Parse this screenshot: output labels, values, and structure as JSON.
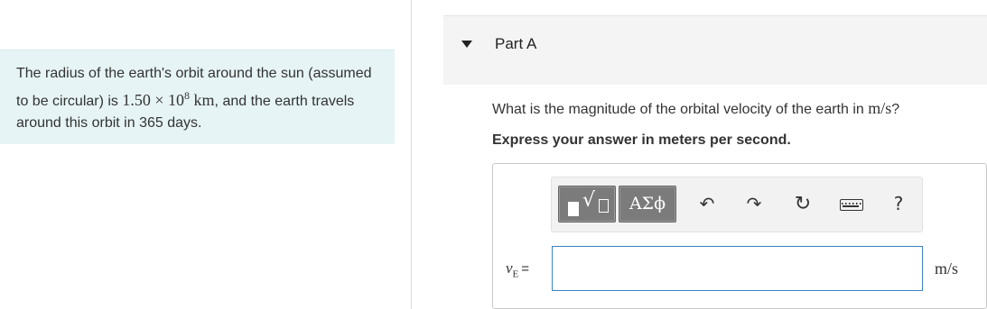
{
  "problem": {
    "intro_before": "The radius of the earth's orbit around the sun (assumed to be circular) is ",
    "intro_math": "1.50 × 10",
    "intro_exp": "8",
    "intro_unit": " km",
    "intro_after": ", and the earth travels around this orbit in 365 days."
  },
  "part": {
    "title": "Part A",
    "question_before": "What is the magnitude of the orbital velocity of the earth in ",
    "question_unit": "m/s",
    "question_after": "?",
    "instruction": "Express your answer in meters per second."
  },
  "toolbar": {
    "greek_label": "ΑΣϕ",
    "undo_icon": "undo-icon",
    "redo_icon": "redo-icon",
    "reset_icon": "reset-icon",
    "keyboard_icon": "keyboard-icon",
    "help_label": "?"
  },
  "answer": {
    "variable": "v",
    "subscript": "E",
    "equals": "=",
    "value": "",
    "unit": "m/s"
  }
}
